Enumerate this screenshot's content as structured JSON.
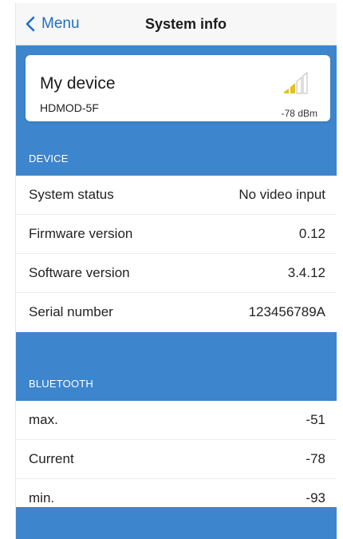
{
  "nav": {
    "back_label": "Menu",
    "title": "System info"
  },
  "device_card": {
    "name": "My device",
    "model": "HDMOD-5F",
    "signal": "-78 dBm",
    "signal_icon": "signal-strength-icon"
  },
  "sections": {
    "device": {
      "header": "DEVICE",
      "rows": [
        {
          "label": "System status",
          "value": "No video input"
        },
        {
          "label": "Firmware version",
          "value": "0.12"
        },
        {
          "label": "Software version",
          "value": "3.4.12"
        },
        {
          "label": "Serial number",
          "value": "123456789A"
        }
      ]
    },
    "bluetooth": {
      "header": "BLUETOOTH",
      "rows": [
        {
          "label": "max.",
          "value": "-51"
        },
        {
          "label": "Current",
          "value": "-78"
        },
        {
          "label": "min.",
          "value": "-93"
        }
      ]
    }
  },
  "colors": {
    "accent": "#3d85cc",
    "link": "#1f6fc6",
    "signal_active": "#e2c21c"
  }
}
